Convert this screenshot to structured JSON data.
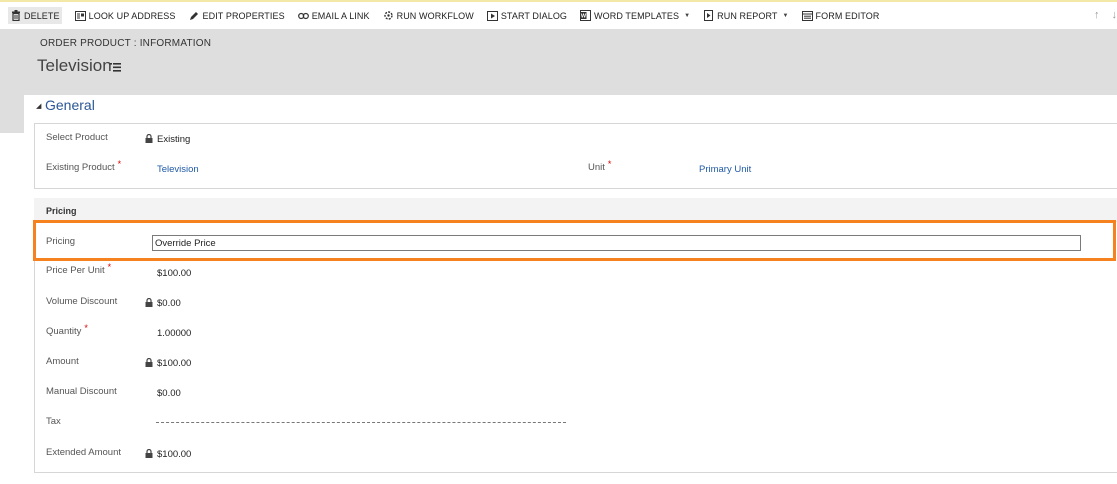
{
  "command_bar": {
    "items": [
      {
        "label": "DELETE",
        "icon": "trash-icon"
      },
      {
        "label": "LOOK UP ADDRESS",
        "icon": "address-book-icon"
      },
      {
        "label": "EDIT PROPERTIES",
        "icon": "pencil-icon"
      },
      {
        "label": "EMAIL A LINK",
        "icon": "link-icon"
      },
      {
        "label": "RUN WORKFLOW",
        "icon": "workflow-icon"
      },
      {
        "label": "START DIALOG",
        "icon": "dialog-icon"
      },
      {
        "label": "WORD TEMPLATES",
        "icon": "word-icon",
        "dropdown": true
      },
      {
        "label": "RUN REPORT",
        "icon": "report-icon",
        "dropdown": true
      },
      {
        "label": "FORM EDITOR",
        "icon": "form-icon"
      }
    ],
    "nav_up": "↑",
    "nav_down": "↓"
  },
  "header": {
    "entity_label": "ORDER PRODUCT : INFORMATION",
    "record_title": "Television"
  },
  "general_section": {
    "title": "General",
    "select_product": {
      "label": "Select Product",
      "value": "Existing",
      "locked": true
    },
    "existing_product": {
      "label": "Existing Product",
      "required_mark": "*",
      "value": "Television"
    },
    "unit": {
      "label": "Unit",
      "required_mark": "*",
      "value": "Primary Unit"
    }
  },
  "pricing_section": {
    "title": "Pricing",
    "pricing": {
      "label": "Pricing",
      "value": "Override Price"
    },
    "price_per_unit": {
      "label": "Price Per Unit",
      "required_mark": "*",
      "value": "$100.00"
    },
    "volume_discount": {
      "label": "Volume Discount",
      "value": "$0.00",
      "locked": true
    },
    "quantity": {
      "label": "Quantity",
      "required_mark": "*",
      "value": "1.00000"
    },
    "amount": {
      "label": "Amount",
      "value": "$100.00",
      "locked": true
    },
    "manual_discount": {
      "label": "Manual Discount",
      "value": "$0.00"
    },
    "tax": {
      "label": "Tax",
      "value": ""
    },
    "extended_amount": {
      "label": "Extended Amount",
      "value": "$100.00",
      "locked": true
    }
  },
  "colors": {
    "highlight": "#f5821f",
    "link": "#1f5aa6",
    "section_title": "#2b5797",
    "required": "#dd0000",
    "header_band": "#dedede"
  }
}
